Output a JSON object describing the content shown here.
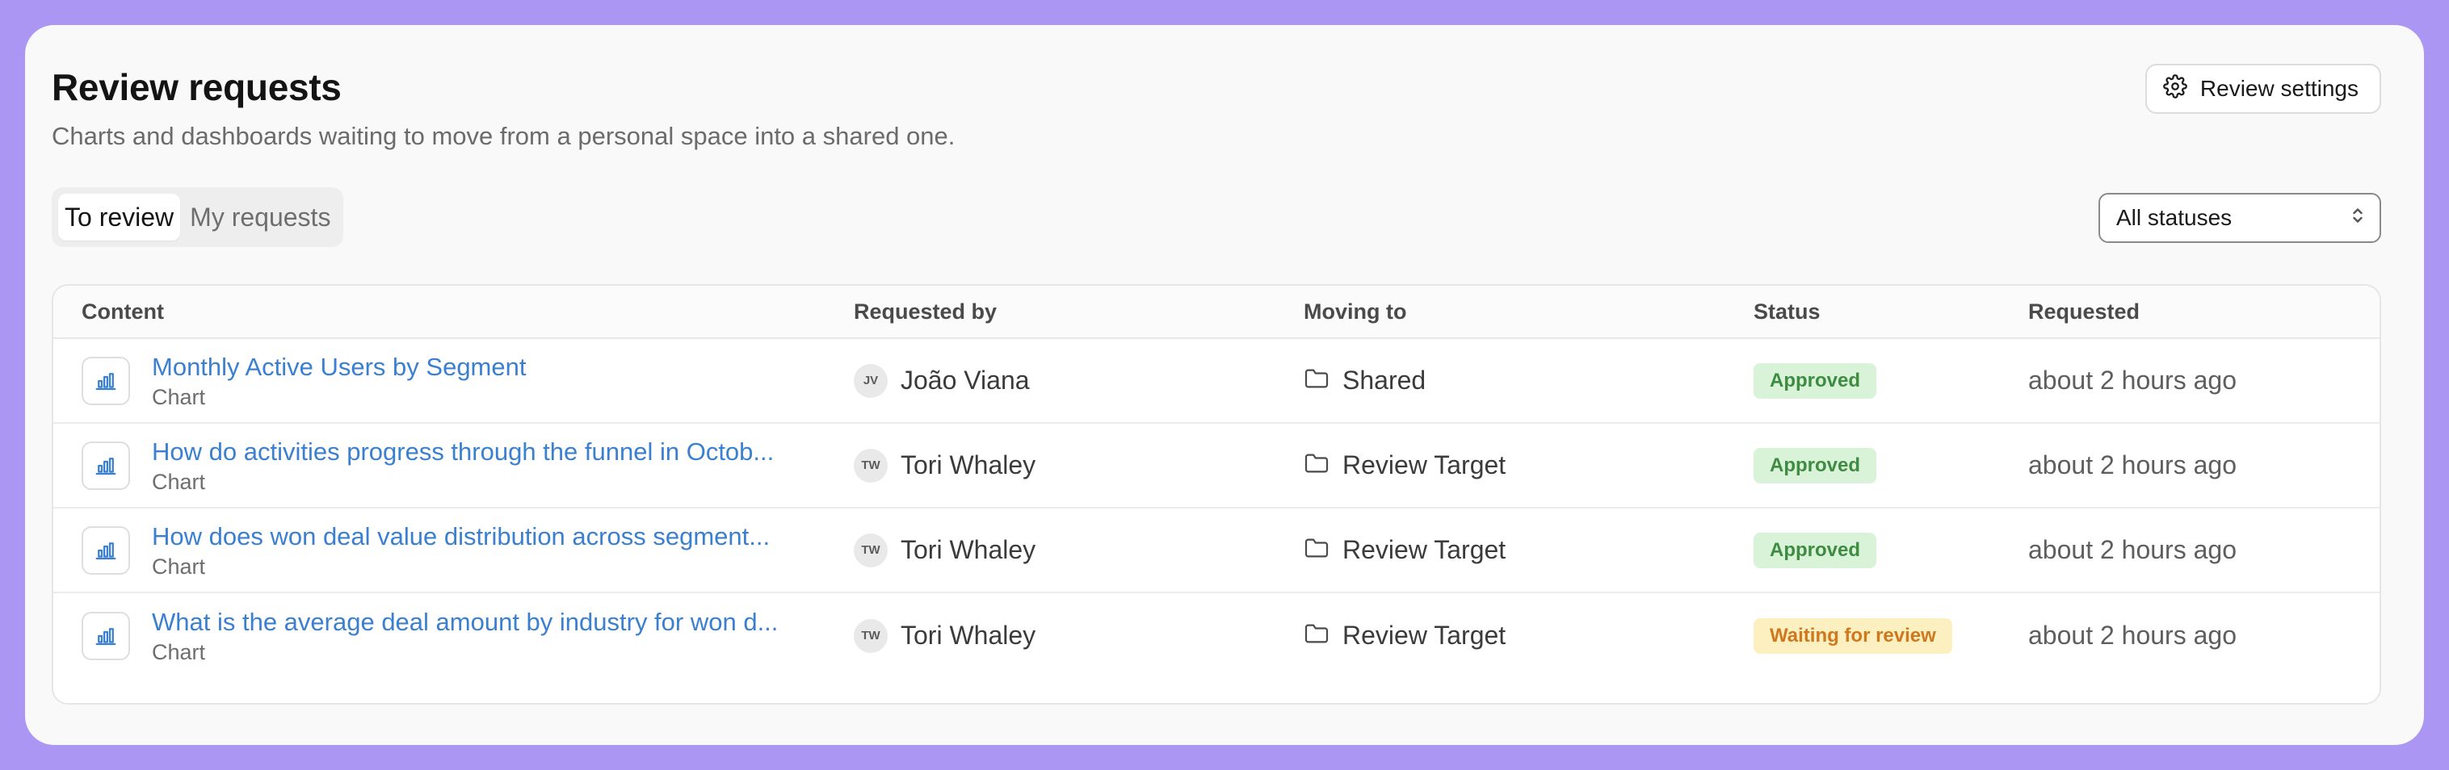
{
  "header": {
    "title": "Review requests",
    "subtitle": "Charts and dashboards waiting to move from a personal space into a shared one.",
    "settings_label": "Review settings"
  },
  "tabs": [
    {
      "label": "To review",
      "active": true
    },
    {
      "label": "My requests",
      "active": false
    }
  ],
  "filter": {
    "selected": "All statuses"
  },
  "table": {
    "columns": [
      "Content",
      "Requested by",
      "Moving to",
      "Status",
      "Requested"
    ],
    "rows": [
      {
        "title": "Monthly Active Users by Segment",
        "type": "Chart",
        "initials": "JV",
        "requester": "João Viana",
        "destination": "Shared",
        "status": "Approved",
        "status_kind": "approved",
        "requested": "about 2 hours ago"
      },
      {
        "title": "How do activities progress through the funnel in Octob...",
        "type": "Chart",
        "initials": "TW",
        "requester": "Tori Whaley",
        "destination": "Review Target",
        "status": "Approved",
        "status_kind": "approved",
        "requested": "about 2 hours ago"
      },
      {
        "title": "How does won deal value distribution across segment...",
        "type": "Chart",
        "initials": "TW",
        "requester": "Tori Whaley",
        "destination": "Review Target",
        "status": "Approved",
        "status_kind": "approved",
        "requested": "about 2 hours ago"
      },
      {
        "title": "What is the average deal amount by industry for won d...",
        "type": "Chart",
        "initials": "TW",
        "requester": "Tori Whaley",
        "destination": "Review Target",
        "status": "Waiting for review",
        "status_kind": "waiting",
        "requested": "about 2 hours ago"
      }
    ]
  },
  "colors": {
    "background": "#ab97f3",
    "link": "#3a7fd0",
    "approved_bg": "#d9f3d9",
    "approved_text": "#3e8b41",
    "waiting_bg": "#fcefc0",
    "waiting_text": "#d0781d"
  },
  "icons": {
    "settings": "gear-icon",
    "select": "chevron-up-down-icon",
    "content": "bar-chart-icon",
    "destination": "folder-icon"
  }
}
